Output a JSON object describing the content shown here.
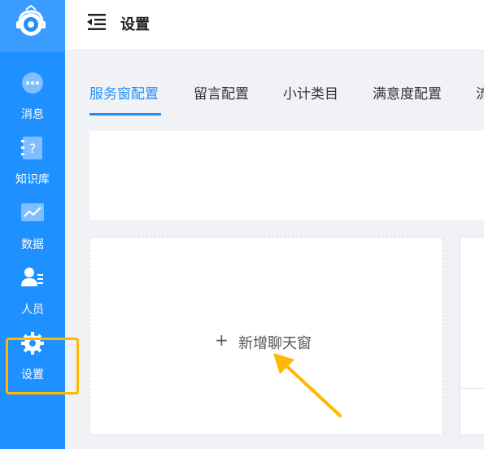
{
  "sidebar": {
    "logo_icon": "robot-headset-icon",
    "items": [
      {
        "label": "消息",
        "icon": "chat-bubble-icon"
      },
      {
        "label": "知识库",
        "icon": "question-book-icon"
      },
      {
        "label": "数据",
        "icon": "line-chart-icon"
      },
      {
        "label": "人员",
        "icon": "person-list-icon"
      },
      {
        "label": "设置",
        "icon": "gear-icon"
      }
    ],
    "active": "设置"
  },
  "header": {
    "title": "设置",
    "menu_icon": "menu-collapse-icon"
  },
  "tabs": [
    {
      "label": "服务窗配置",
      "active": true
    },
    {
      "label": "留言配置",
      "active": false
    },
    {
      "label": "小计类目",
      "active": false
    },
    {
      "label": "满意度配置",
      "active": false
    },
    {
      "label": "流",
      "active": false
    }
  ],
  "main": {
    "add_card": {
      "plus": "+",
      "label": "新增聊天窗"
    }
  },
  "colors": {
    "sidebar": "#1e90ff",
    "accent": "#1e90ff",
    "highlight": "#ffb700"
  }
}
